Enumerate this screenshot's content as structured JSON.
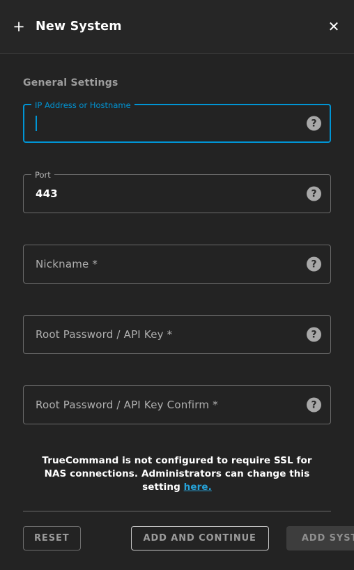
{
  "header": {
    "add_icon": "plus-icon",
    "title": "New System",
    "close_icon": "close-icon"
  },
  "form": {
    "section_title": "General Settings",
    "help_glyph": "?",
    "fields": [
      {
        "name": "ip-address-or-hostname",
        "label": "IP Address or Hostname",
        "value": "",
        "focused": true,
        "required": false
      },
      {
        "name": "port",
        "label": "Port",
        "value": "443",
        "focused": false,
        "required": false
      },
      {
        "name": "nickname",
        "label": "Nickname *",
        "value": "",
        "focused": false,
        "required": true
      },
      {
        "name": "root-password-api-key",
        "label": "Root Password / API Key *",
        "value": "",
        "focused": false,
        "required": true
      },
      {
        "name": "root-password-api-key-confirm",
        "label": "Root Password / API Key Confirm *",
        "value": "",
        "focused": false,
        "required": true
      }
    ]
  },
  "notice": {
    "text": "TrueCommand is not configured to require SSL for NAS connections. Administrators can change this setting ",
    "link_text": "here."
  },
  "buttons": {
    "reset": "RESET",
    "add_and_continue": "ADD AND CONTINUE",
    "add_system": "ADD SYSTEM"
  },
  "colors": {
    "background": "#232323",
    "header_background": "#262626",
    "accent": "#0095d5",
    "link": "#26a2d8",
    "border": "#6b6b6b",
    "muted_text": "#9d9d9d",
    "help_icon_background": "#a8a8a8",
    "add_system_background": "#3d3d3d"
  }
}
